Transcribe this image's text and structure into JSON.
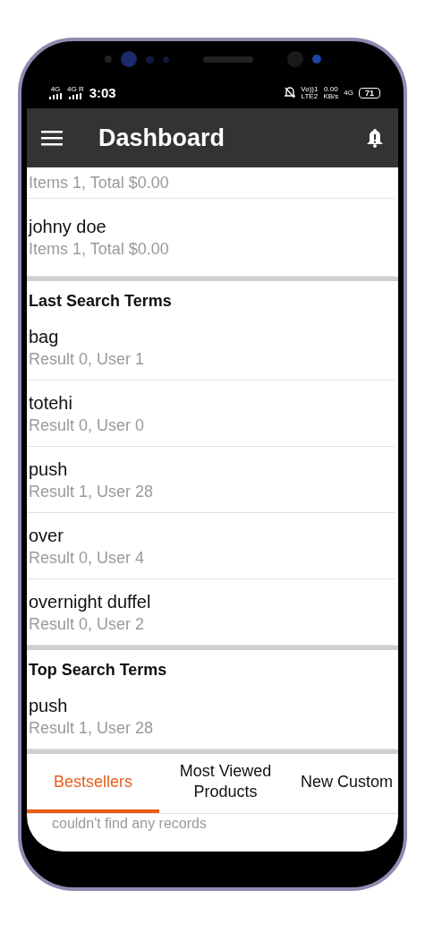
{
  "status_bar": {
    "signal_labels": [
      "4G",
      "4G R"
    ],
    "time": "3:03",
    "volte": "Vo))1",
    "lte": "LTE2",
    "speed": "0.00",
    "speed_unit": "KB/s",
    "network": "4G",
    "battery": "71"
  },
  "app_bar": {
    "title": "Dashboard"
  },
  "customers": [
    {
      "detail": "Items 1, Total $0.00"
    },
    {
      "name": "johny doe",
      "detail": "Items 1, Total $0.00"
    }
  ],
  "sections": [
    {
      "title": "Last Search Terms",
      "items": [
        {
          "term": "bag",
          "detail": "Result 0, User 1"
        },
        {
          "term": "totehi",
          "detail": "Result 0, User 0"
        },
        {
          "term": "push",
          "detail": "Result 1, User 28"
        },
        {
          "term": "over",
          "detail": "Result 0, User 4"
        },
        {
          "term": "overnight duffel",
          "detail": "Result 0, User 2"
        }
      ]
    },
    {
      "title": "Top Search Terms",
      "items": [
        {
          "term": "push",
          "detail": "Result 1, User 28"
        }
      ]
    }
  ],
  "tabs": [
    {
      "label": "Bestsellers",
      "selected": true
    },
    {
      "label": "Most Viewed Products",
      "selected": false
    },
    {
      "label": "New Custom",
      "selected": false
    }
  ],
  "empty_message": "couldn't find any records"
}
